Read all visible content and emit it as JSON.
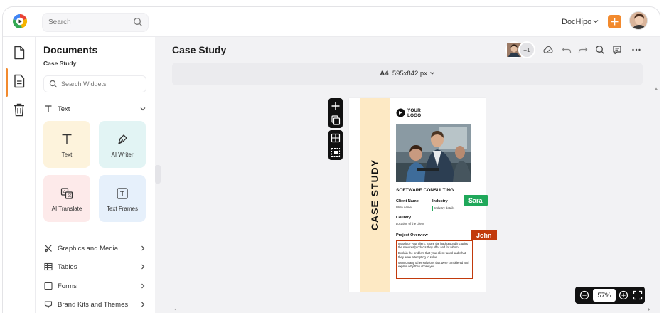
{
  "topbar": {
    "search_placeholder": "Search",
    "brand_label": "DocHipo",
    "plus_label": "+"
  },
  "panel": {
    "title": "Documents",
    "subtitle": "Case Study",
    "search_placeholder": "Search Widgets",
    "text_section": "Text",
    "tiles": [
      "Text",
      "AI Writer",
      "AI Translate",
      "Text Frames"
    ],
    "sections": [
      "Graphics and Media",
      "Tables",
      "Forms",
      "Brand Kits and Themes"
    ]
  },
  "editor": {
    "doc_title": "Case Study",
    "collab_more": "+1",
    "page_format": "A4",
    "page_dims": "595x842 px"
  },
  "page": {
    "vertical_title": "CASE STUDY",
    "logo_line1": "YOUR",
    "logo_line2": "LOGO",
    "heading": "SOFTWARE CONSULTING",
    "client_name_label": "Client Name",
    "client_name_value": "Write name",
    "industry_label": "Industry",
    "industry_value": "Industry details",
    "country_label": "Country",
    "country_value": "Location of the client",
    "overview_label": "Project Overview",
    "overview_p1": "Introduce your client. Share the background including the services/products they offer and for whom.",
    "overview_p2": "Explain the problem that your client faced and what they were attempting to solve.",
    "overview_p3": "Mention any other solutions that were considered and explain why they chose you"
  },
  "collaborators": [
    {
      "name": "Sara",
      "color": "#1fa85a"
    },
    {
      "name": "John",
      "color": "#c23a0c"
    }
  ],
  "zoom": {
    "level": "57%"
  },
  "colors": {
    "accent": "#f28a2e",
    "stripe": "#fde9c4"
  }
}
